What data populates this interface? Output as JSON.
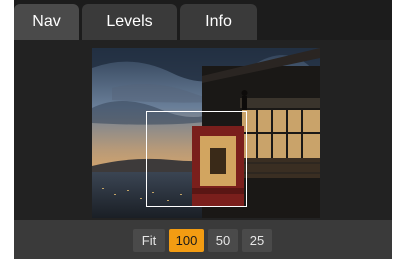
{
  "tabs": [
    {
      "label": "Nav",
      "active": true
    },
    {
      "label": "Levels",
      "active": false
    },
    {
      "label": "Info",
      "active": false
    }
  ],
  "zoom": {
    "options": [
      "Fit",
      "100",
      "50",
      "25"
    ],
    "selected": "100"
  },
  "colors": {
    "panel_bg": "#1e1e1e",
    "tab_active": "#4a4a4a",
    "tab_inactive": "#3a3a3a",
    "accent": "#f39c12"
  }
}
